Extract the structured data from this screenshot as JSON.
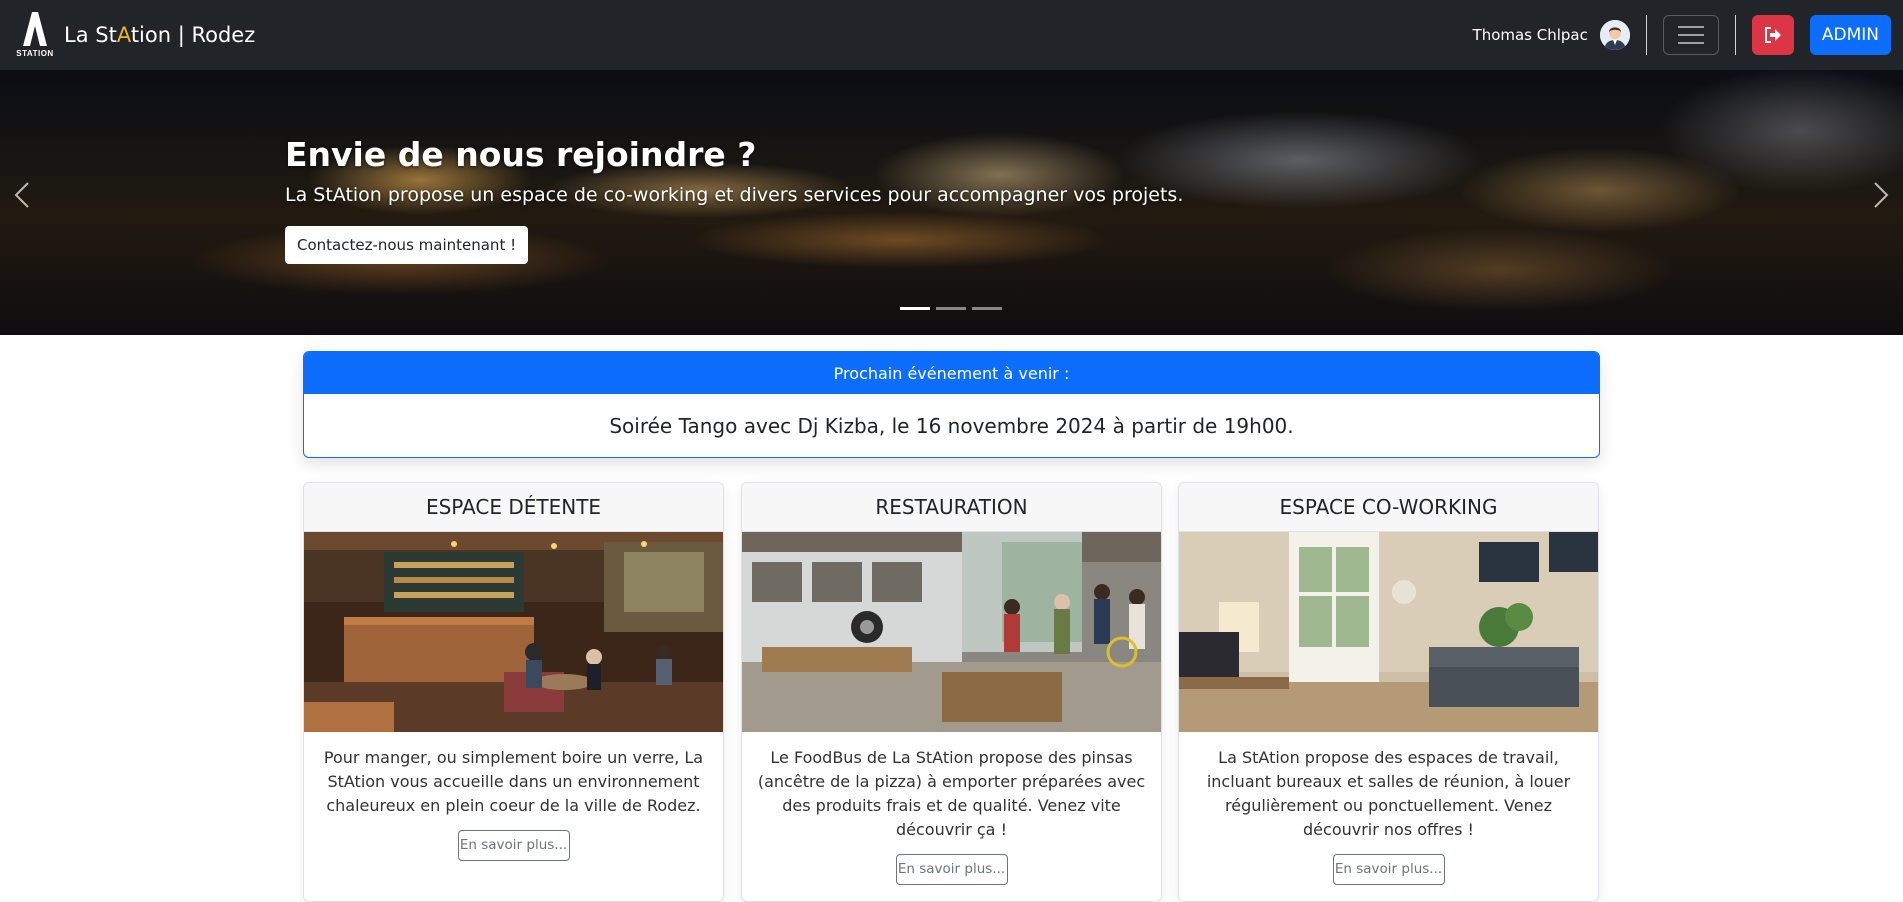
{
  "navbar": {
    "logo_text": "STATION",
    "brand": {
      "part1": "La St",
      "accent": "A",
      "part2": "tion | Rodez"
    },
    "user_name": "Thomas Chlpac",
    "admin_label": "ADMIN"
  },
  "hero": {
    "title": "Envie de nous rejoindre ?",
    "subtitle": "La StAtion propose un espace de co-working et divers services pour accompagner vos projets.",
    "cta_label": "Contactez-nous maintenant !",
    "slides_count": 3,
    "active_slide": 1
  },
  "event": {
    "header": "Prochain événement à venir :",
    "text": "Soirée Tango avec Dj Kizba, le 16 novembre 2024 à partir de 19h00."
  },
  "cards": [
    {
      "title": "ESPACE DÉTENTE",
      "text": "Pour manger, ou simplement boire un verre, La StAtion vous accueille dans un environnement chaleureux en plein coeur de la ville de Rodez.",
      "button": "En savoir plus..."
    },
    {
      "title": "RESTAURATION",
      "text": "Le FoodBus de La StAtion propose des pinsas (ancêtre de la pizza) à emporter préparées avec des produits frais et de qualité. Venez vite découvrir ça !",
      "button": "En savoir plus..."
    },
    {
      "title": "ESPACE CO-WORKING",
      "text": "La StAtion propose des espaces de travail, incluant bureaux et salles de réunion, à louer régulièrement ou ponctuellement. Venez découvrir nos offres !",
      "button": "En savoir plus..."
    }
  ],
  "colors": {
    "navbar_bg": "#212529",
    "primary": "#0d6efd",
    "danger": "#dc3545",
    "brand_accent": "#f0b429"
  },
  "icons": [
    "station-logo-icon",
    "avatar-icon",
    "hamburger-icon",
    "logout-icon",
    "chevron-left-icon",
    "chevron-right-icon"
  ]
}
